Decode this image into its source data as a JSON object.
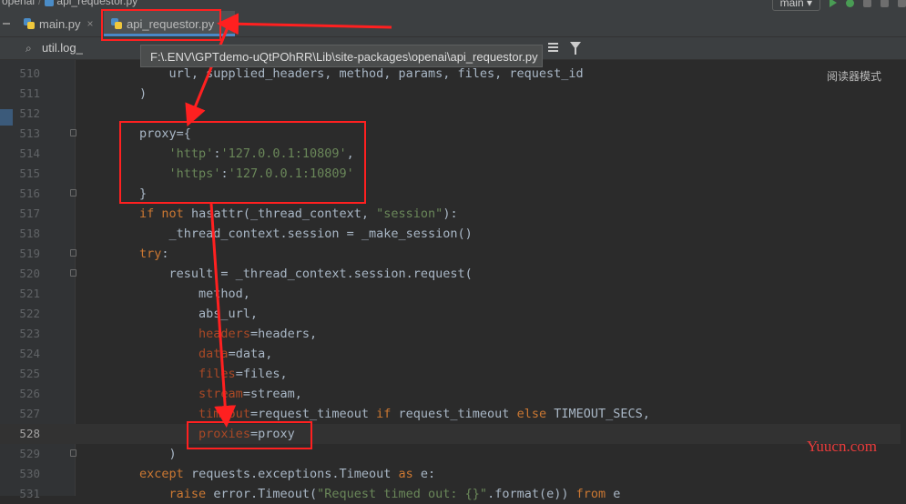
{
  "breadcrumb": {
    "root": "openai",
    "file": "api_requestor.py"
  },
  "toolbar": {
    "branch": "main"
  },
  "tabs": [
    {
      "label": "main.py",
      "close": "×"
    },
    {
      "label": "api_requestor.py",
      "close": "×"
    }
  ],
  "search": {
    "query": "util.log_"
  },
  "tooltip": {
    "path": "F:\\.ENV\\GPTdemo-uQtPOhRR\\Lib\\site-packages\\openai\\api_requestor.py"
  },
  "editor": {
    "reader_mode": "阅读器模式",
    "current_line": 528,
    "lines": [
      {
        "num": "510",
        "tokens": [
          {
            "t": "            url, supplied_headers, method, params, files, request_id",
            "c": ""
          }
        ]
      },
      {
        "num": "511",
        "tokens": [
          {
            "t": "        )",
            "c": ""
          }
        ]
      },
      {
        "num": "512",
        "tokens": []
      },
      {
        "num": "513",
        "fold": true,
        "tokens": [
          {
            "t": "        proxy={",
            "c": ""
          }
        ]
      },
      {
        "num": "514",
        "tokens": [
          {
            "t": "            ",
            "c": ""
          },
          {
            "t": "'http'",
            "c": "str"
          },
          {
            "t": ":",
            "c": ""
          },
          {
            "t": "'127.0.0.1:10809'",
            "c": "str"
          },
          {
            "t": ",",
            "c": ""
          }
        ]
      },
      {
        "num": "515",
        "tokens": [
          {
            "t": "            ",
            "c": ""
          },
          {
            "t": "'https'",
            "c": "str"
          },
          {
            "t": ":",
            "c": ""
          },
          {
            "t": "'127.0.0.1:10809'",
            "c": "str"
          }
        ]
      },
      {
        "num": "516",
        "fold": true,
        "tokens": [
          {
            "t": "        }",
            "c": ""
          }
        ]
      },
      {
        "num": "517",
        "tokens": [
          {
            "t": "        ",
            "c": ""
          },
          {
            "t": "if not ",
            "c": "kw"
          },
          {
            "t": "hasattr",
            "c": ""
          },
          {
            "t": "(_thread_context, ",
            "c": ""
          },
          {
            "t": "\"session\"",
            "c": "str"
          },
          {
            "t": "):",
            "c": ""
          }
        ]
      },
      {
        "num": "518",
        "tokens": [
          {
            "t": "            _thread_context.session = _make_session()",
            "c": ""
          }
        ]
      },
      {
        "num": "519",
        "fold": true,
        "tokens": [
          {
            "t": "        ",
            "c": ""
          },
          {
            "t": "try",
            "c": "kw"
          },
          {
            "t": ":",
            "c": ""
          }
        ]
      },
      {
        "num": "520",
        "fold": true,
        "tokens": [
          {
            "t": "            result = _thread_context.session.request(",
            "c": ""
          }
        ]
      },
      {
        "num": "521",
        "tokens": [
          {
            "t": "                method,",
            "c": ""
          }
        ]
      },
      {
        "num": "522",
        "tokens": [
          {
            "t": "                abs_url,",
            "c": ""
          }
        ]
      },
      {
        "num": "523",
        "tokens": [
          {
            "t": "                ",
            "c": ""
          },
          {
            "t": "headers",
            "c": "param"
          },
          {
            "t": "=headers,",
            "c": ""
          }
        ]
      },
      {
        "num": "524",
        "tokens": [
          {
            "t": "                ",
            "c": ""
          },
          {
            "t": "data",
            "c": "param"
          },
          {
            "t": "=data,",
            "c": ""
          }
        ]
      },
      {
        "num": "525",
        "tokens": [
          {
            "t": "                ",
            "c": ""
          },
          {
            "t": "files",
            "c": "param"
          },
          {
            "t": "=files,",
            "c": ""
          }
        ]
      },
      {
        "num": "526",
        "tokens": [
          {
            "t": "                ",
            "c": ""
          },
          {
            "t": "stream",
            "c": "param"
          },
          {
            "t": "=stream,",
            "c": ""
          }
        ]
      },
      {
        "num": "527",
        "tokens": [
          {
            "t": "                ",
            "c": ""
          },
          {
            "t": "timeout",
            "c": "param"
          },
          {
            "t": "=request_timeout ",
            "c": ""
          },
          {
            "t": "if ",
            "c": "kw"
          },
          {
            "t": "request_timeout ",
            "c": ""
          },
          {
            "t": "else ",
            "c": "kw"
          },
          {
            "t": "TIMEOUT_SECS,",
            "c": ""
          }
        ]
      },
      {
        "num": "528",
        "tokens": [
          {
            "t": "                ",
            "c": ""
          },
          {
            "t": "proxies",
            "c": "param"
          },
          {
            "t": "=proxy",
            "c": ""
          }
        ]
      },
      {
        "num": "529",
        "fold": true,
        "tokens": [
          {
            "t": "            )",
            "c": ""
          }
        ]
      },
      {
        "num": "530",
        "tokens": [
          {
            "t": "        ",
            "c": ""
          },
          {
            "t": "except ",
            "c": "kw"
          },
          {
            "t": "requests.exceptions.Timeout ",
            "c": ""
          },
          {
            "t": "as ",
            "c": "kw"
          },
          {
            "t": "e:",
            "c": ""
          }
        ]
      },
      {
        "num": "531",
        "tokens": [
          {
            "t": "            ",
            "c": ""
          },
          {
            "t": "raise ",
            "c": "kw"
          },
          {
            "t": "error.Timeout(",
            "c": ""
          },
          {
            "t": "\"Request timed out: {}\"",
            "c": "str"
          },
          {
            "t": ".format(e)) ",
            "c": ""
          },
          {
            "t": "from ",
            "c": "kw"
          },
          {
            "t": "e",
            "c": ""
          }
        ]
      }
    ]
  },
  "watermark": "Yuucn.com",
  "colors": {
    "accent": "#4a88c7",
    "annotation": "#ff2020",
    "background": "#2b2b2b"
  }
}
